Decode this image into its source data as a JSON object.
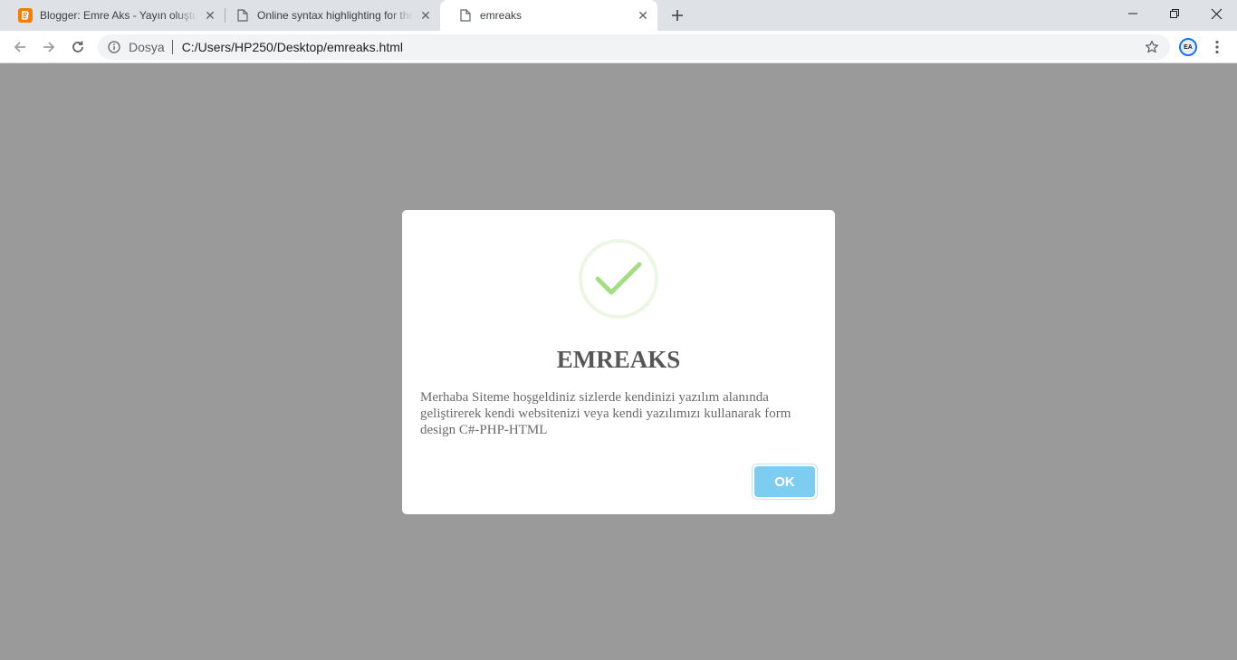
{
  "browser": {
    "tabs": [
      {
        "title": "Blogger: Emre Aks - Yayın oluştur",
        "favicon": "blogger-icon",
        "active": false
      },
      {
        "title": "Online syntax highlighting for the web",
        "favicon": "page-icon",
        "active": false
      },
      {
        "title": "emreaks",
        "favicon": "page-icon",
        "active": true
      }
    ],
    "address": {
      "scheme_label": "Dosya",
      "url": "C:/Users/HP250/Desktop/emreaks.html"
    },
    "profile_initials": "EA",
    "accent_color": "#1a73e8"
  },
  "dialog": {
    "icon": "checkmark-icon",
    "title": "EMREAKS",
    "message": "Merhaba Siteme hoşgeldiniz sizlerde kendinizi yazılım alanında geliştirerek kendi websitenizi veya kendi yazılımızı kullanarak form design C#-PHP-HTML",
    "confirm_label": "OK",
    "confirm_color": "#7ccdef",
    "success_color": "#a5dc86"
  }
}
